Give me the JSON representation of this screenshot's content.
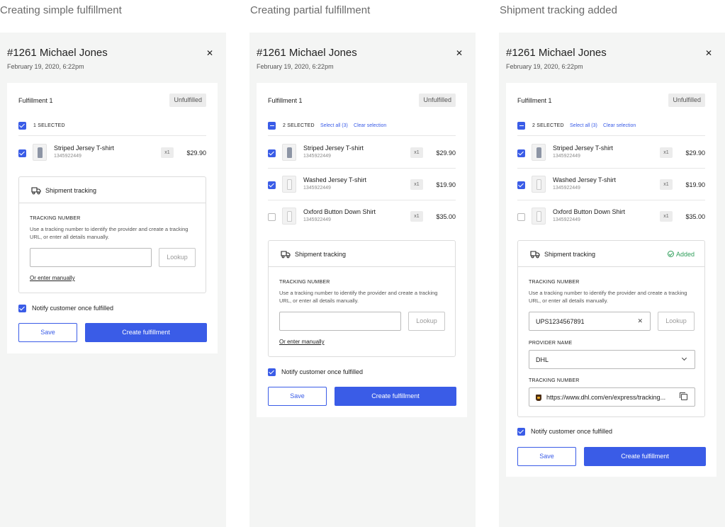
{
  "colors": {
    "accent": "#3a5ce7",
    "success": "#2f9e5a",
    "panel": "#f4f5f4"
  },
  "columns": [
    {
      "heading": "Creating simple fulfillment",
      "order_title": "#1261 Michael Jones",
      "order_date": "February 19, 2020, 6:22pm",
      "fulfillment_title": "Fulfillment 1",
      "status_badge": "Unfulfilled",
      "selection": {
        "text": "1 SELECTED",
        "select_all": "",
        "clear": ""
      },
      "items": [
        {
          "name": "Striped Jersey T-shirt",
          "sku": "1345922449",
          "qty": "x1",
          "price": "$29.90",
          "checked": true
        }
      ],
      "shipment": {
        "title": "Shipment tracking",
        "status": "",
        "tracking_label": "TRACKING NUMBER",
        "help": "Use a tracking number to identify the provider and create a tracking URL, or enter all details manually.",
        "tracking_value": "",
        "lookup": "Lookup",
        "manual_link": "Or enter manually"
      },
      "notify": "Notify customer once fulfilled",
      "save": "Save",
      "create": "Create fulfillment"
    },
    {
      "heading": "Creating partial fulfillment",
      "order_title": "#1261 Michael Jones",
      "order_date": "February 19, 2020, 6:22pm",
      "fulfillment_title": "Fulfillment 1",
      "status_badge": "Unfulfilled",
      "selection": {
        "text": "2 SELECTED",
        "select_all": "Select all (3)",
        "clear": "Clear selection"
      },
      "items": [
        {
          "name": "Striped Jersey T-shirt",
          "sku": "1345922449",
          "qty": "x1",
          "price": "$29.90",
          "checked": true
        },
        {
          "name": "Washed Jersey T-shirt",
          "sku": "1345922449",
          "qty": "x1",
          "price": "$19.90",
          "checked": true
        },
        {
          "name": "Oxford Button Down Shirt",
          "sku": "1345922449",
          "qty": "x1",
          "price": "$35.00",
          "checked": false
        }
      ],
      "shipment": {
        "title": "Shipment tracking",
        "status": "",
        "tracking_label": "TRACKING NUMBER",
        "help": "Use a tracking number to identify the provider and create a tracking URL, or enter all details manually.",
        "tracking_value": "",
        "lookup": "Lookup",
        "manual_link": "Or enter manually"
      },
      "notify": "Notify customer once fulfilled",
      "save": "Save",
      "create": "Create fulfillment"
    },
    {
      "heading": "Shipment tracking added",
      "order_title": "#1261 Michael Jones",
      "order_date": "February 19, 2020, 6:22pm",
      "fulfillment_title": "Fulfillment 1",
      "status_badge": "Unfulfilled",
      "selection": {
        "text": "2 SELECTED",
        "select_all": "Select all (3)",
        "clear": "Clear selection"
      },
      "items": [
        {
          "name": "Striped Jersey T-shirt",
          "sku": "1345922449",
          "qty": "x1",
          "price": "$29.90",
          "checked": true
        },
        {
          "name": "Washed Jersey T-shirt",
          "sku": "1345922449",
          "qty": "x1",
          "price": "$19.90",
          "checked": true
        },
        {
          "name": "Oxford Button Down Shirt",
          "sku": "1345922449",
          "qty": "x1",
          "price": "$35.00",
          "checked": false
        }
      ],
      "shipment": {
        "title": "Shipment tracking",
        "status": "Added",
        "tracking_label": "TRACKING NUMBER",
        "help": "Use a tracking number to identify the provider and create a tracking URL, or enter all details manually.",
        "tracking_value": "UPS1234567891",
        "lookup": "Lookup",
        "provider_label": "PROVIDER NAME",
        "provider_value": "DHL",
        "url_label": "TRACKING NUMBER",
        "url_value": "https://www.dhl.com/en/express/tracking..."
      },
      "notify": "Notify customer once fulfilled",
      "save": "Save",
      "create": "Create fulfillment"
    }
  ]
}
